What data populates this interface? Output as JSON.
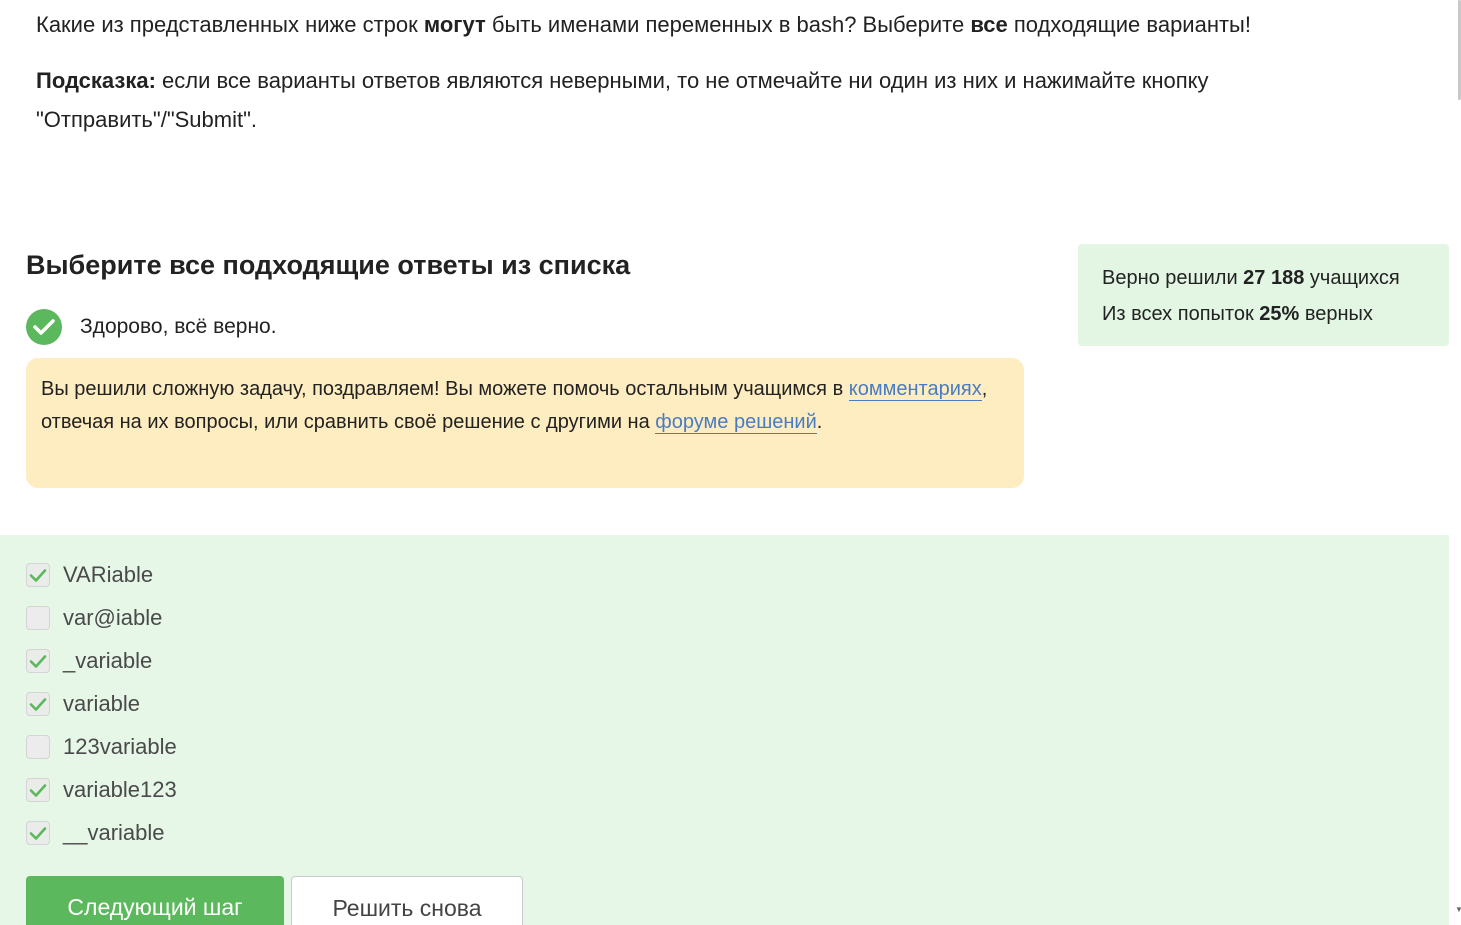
{
  "question": {
    "part1": "Какие из представленных ниже строк ",
    "bold1": "могут",
    "part2": " быть именами переменных в bash? Выберите ",
    "bold2": "все",
    "part3": " подходящие варианты!"
  },
  "hint": {
    "label": "Подсказка:",
    "text": " если все варианты ответов являются неверными, то не отмечайте ни один из них и нажимайте кнопку \"Отправить\"/\"Submit\"."
  },
  "section_title": "Выберите все подходящие ответы из списка",
  "result": {
    "message": "Здорово, всё верно.",
    "status_color": "#5cb85c"
  },
  "congrats": {
    "text1": "Вы решили сложную задачу, поздравляем! Вы можете помочь остальным учащимся в ",
    "link1": "комментариях",
    "text2": ", отвечая на их вопросы, или сравнить своё решение с другими на ",
    "link2": "форуме решений",
    "text3": "."
  },
  "stats": {
    "line1_prefix": "Верно решили ",
    "line1_value": "27 188",
    "line1_suffix": " учащихся",
    "line2_prefix": "Из всех попыток ",
    "line2_value": "25%",
    "line2_suffix": " верных"
  },
  "options": [
    {
      "label": "VARiable",
      "checked": true
    },
    {
      "label": "var@iable",
      "checked": false
    },
    {
      "label": "_variable",
      "checked": true
    },
    {
      "label": "variable",
      "checked": true
    },
    {
      "label": "123variable",
      "checked": false
    },
    {
      "label": "variable123",
      "checked": true
    },
    {
      "label": "__variable",
      "checked": true
    }
  ],
  "buttons": {
    "next": "Следующий шаг",
    "retry": "Решить снова"
  },
  "colors": {
    "accent_green": "#5cb85c",
    "answers_bg": "#e6f6e7",
    "congrats_bg": "#feedc0",
    "link": "#4a7cc4"
  }
}
